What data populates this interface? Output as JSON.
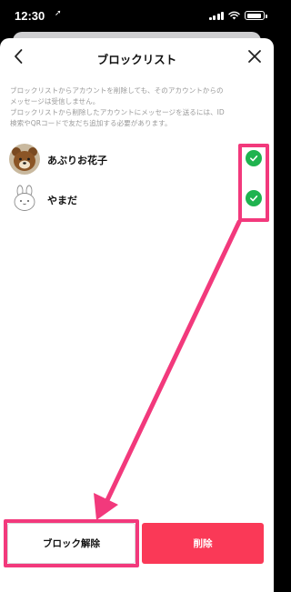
{
  "status_bar": {
    "time": "12:30",
    "location_glyph": "➚"
  },
  "header": {
    "title": "ブロックリスト",
    "back_icon": "chevron-left-icon",
    "close_icon": "close-icon"
  },
  "notice": {
    "lines": [
      "ブロックリストからアカウントを削除しても、そのアカウントからの",
      "メッセージは受信しません。",
      "ブロックリストから削除したアカウントにメッセージを送るには、ID",
      "検索やQRコードで友だち追加する必要があります。"
    ]
  },
  "blocked_list": [
    {
      "name": "あぶりお花子",
      "avatar": "bear-avatar",
      "checked": true
    },
    {
      "name": "やまだ",
      "avatar": "rabbit-avatar",
      "checked": true
    }
  ],
  "footer": {
    "unblock_label": "ブロック解除",
    "delete_label": "削除"
  },
  "colors": {
    "check_green": "#1fb34f",
    "delete_red": "#fa3957",
    "annotation_pink": "#f2397c"
  }
}
